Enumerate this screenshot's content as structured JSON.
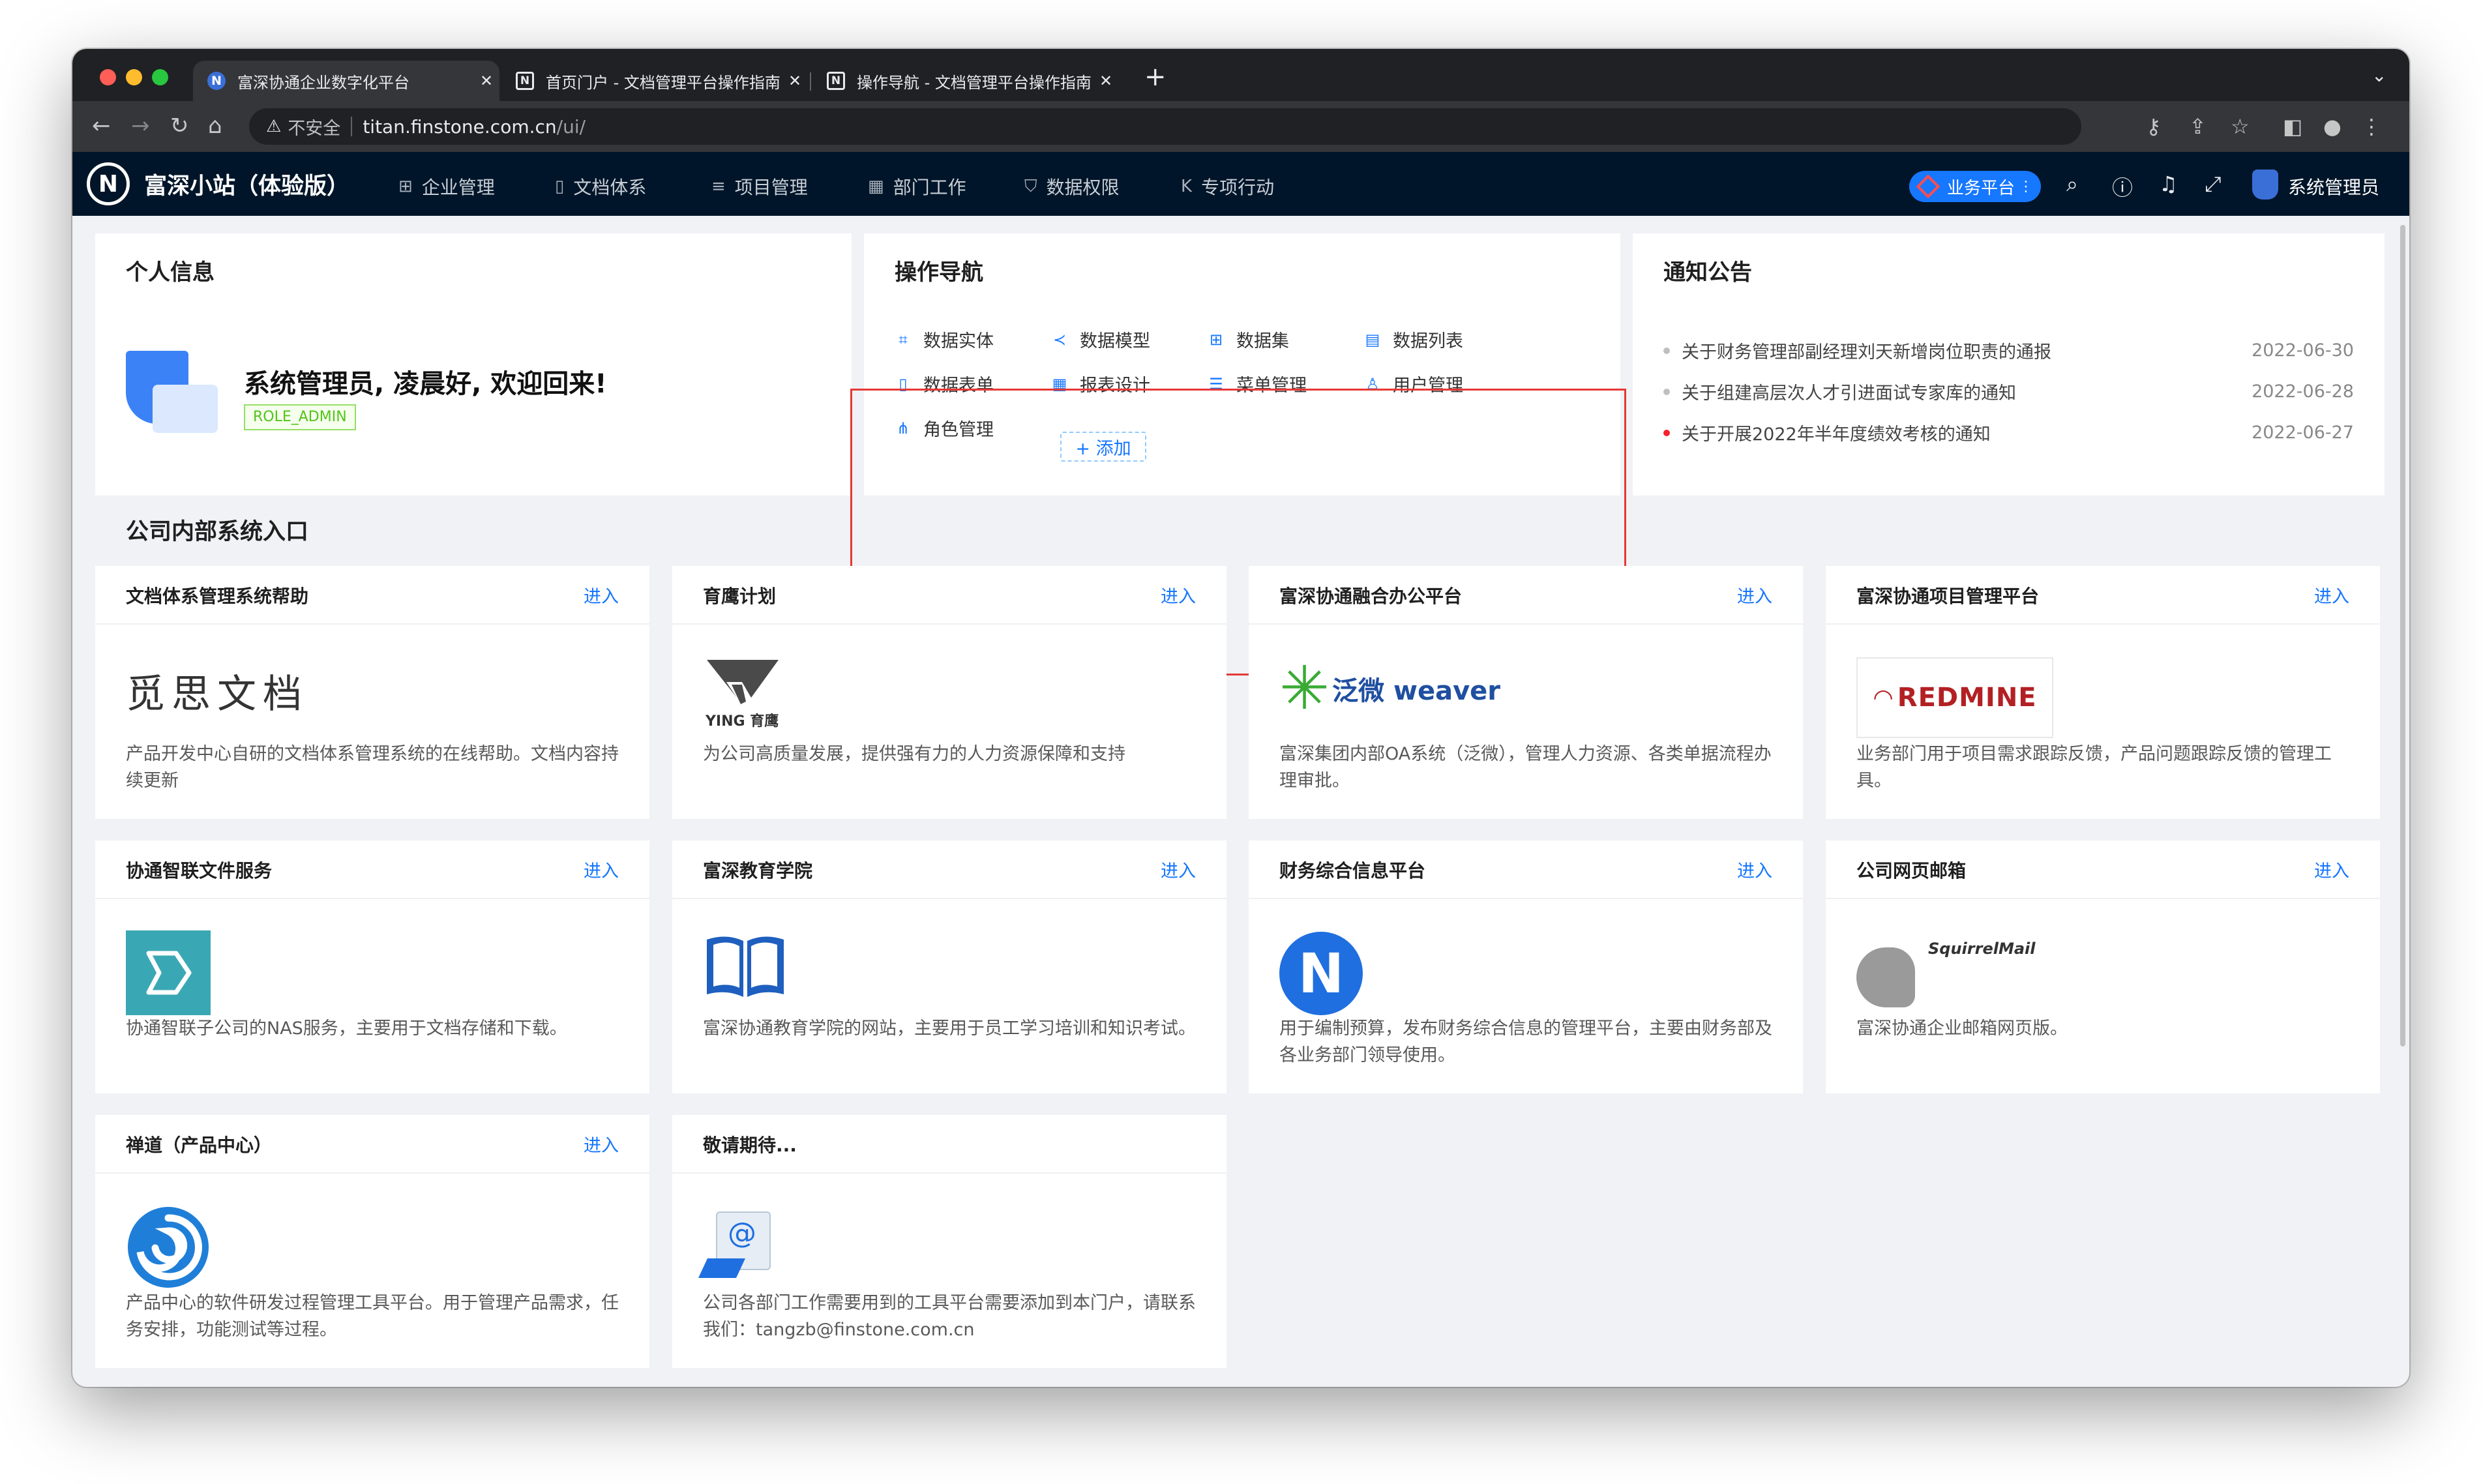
{
  "browser": {
    "tabs": [
      {
        "title": "富深协通企业数字化平台",
        "favicon": "n-logo-icon"
      },
      {
        "title": "首页门户 - 文档管理平台操作指南",
        "favicon": "doc-icon"
      },
      {
        "title": "操作导航 - 文档管理平台操作指南",
        "favicon": "doc-icon"
      }
    ],
    "security_label": "不安全",
    "url_host": "titan.finstone.com.cn",
    "url_path": "/ui/"
  },
  "appnav": {
    "logo": "N",
    "brand": "富深小站（体验版）",
    "menus": [
      {
        "label": "企业管理",
        "icon": "cluster-icon",
        "glyph": "⊞"
      },
      {
        "label": "文档体系",
        "icon": "file-icon",
        "glyph": "▯"
      },
      {
        "label": "项目管理",
        "icon": "list-icon",
        "glyph": "≡"
      },
      {
        "label": "部门工作",
        "icon": "table-icon",
        "glyph": "▦"
      },
      {
        "label": "数据权限",
        "icon": "shield-icon",
        "glyph": "⛉"
      },
      {
        "label": "专项行动",
        "icon": "k-icon",
        "glyph": "K"
      }
    ],
    "platform_button": "业务平台",
    "user": "系统管理员"
  },
  "profile": {
    "title": "个人信息",
    "greeting": "系统管理员, 凌晨好, 欢迎回来!",
    "role": "ROLE_ADMIN"
  },
  "operation_nav": {
    "title": "操作导航",
    "items": [
      {
        "label": "数据实体",
        "icon": "entity-icon",
        "glyph": "⌗"
      },
      {
        "label": "数据模型",
        "icon": "share-icon",
        "glyph": "≺"
      },
      {
        "label": "数据集",
        "icon": "appstore-icon",
        "glyph": "⊞"
      },
      {
        "label": "数据列表",
        "icon": "list-box-icon",
        "glyph": "▤"
      },
      {
        "label": "数据表单",
        "icon": "form-icon",
        "glyph": "▯"
      },
      {
        "label": "报表设计",
        "icon": "table-icon",
        "glyph": "▦"
      },
      {
        "label": "菜单管理",
        "icon": "menu-icon",
        "glyph": "☰"
      },
      {
        "label": "用户管理",
        "icon": "user-icon",
        "glyph": "♙"
      },
      {
        "label": "角色管理",
        "icon": "cluster-icon",
        "glyph": "⋔"
      }
    ],
    "add_label": "+ 添加"
  },
  "notices": {
    "title": "通知公告",
    "items": [
      {
        "text": "关于财务管理部副经理刘天新增岗位职责的通报",
        "date": "2022-06-30",
        "color": "#bfbfbf"
      },
      {
        "text": "关于组建高层次人才引进面试专家库的通知",
        "date": "2022-06-28",
        "color": "#bfbfbf"
      },
      {
        "text": "关于开展2022年半年度绩效考核的通知",
        "date": "2022-06-27",
        "color": "#f5222d"
      }
    ]
  },
  "systems": {
    "title": "公司内部系统入口",
    "enter_label": "进入",
    "items": [
      {
        "name": "文档体系管理系统帮助",
        "desc": "产品开发中心自研的文档体系管理系统的在线帮助。文档内容持续更新",
        "logo": "觅思文档",
        "enter": true
      },
      {
        "name": "育鹰计划",
        "desc": "为公司高质量发展，提供强有力的人力资源保障和支持",
        "logo": "YING 育鹰",
        "enter": true
      },
      {
        "name": "富深协通融合办公平台",
        "desc": "富深集团内部OA系统（泛微），管理人力资源、各类单据流程办理审批。",
        "logo": "泛微 weaver",
        "enter": true
      },
      {
        "name": "富深协通项目管理平台",
        "desc": "业务部门用于项目需求跟踪反馈，产品问题跟踪反馈的管理工具。",
        "logo": "REDMINE",
        "enter": true
      },
      {
        "name": "协通智联文件服务",
        "desc": "协通智联子公司的NAS服务，主要用于文档存储和下载。",
        "logo": "",
        "enter": true
      },
      {
        "name": "富深教育学院",
        "desc": "富深协通教育学院的网站，主要用于员工学习培训和知识考试。",
        "logo": "",
        "enter": true
      },
      {
        "name": "财务综合信息平台",
        "desc": "用于编制预算，发布财务综合信息的管理平台，主要由财务部及各业务部门领导使用。",
        "logo": "N",
        "enter": true
      },
      {
        "name": "公司网页邮箱",
        "desc": "富深协通企业邮箱网页版。",
        "logo": "SquirrelMail",
        "enter": true
      },
      {
        "name": "禅道（产品中心）",
        "desc": "产品中心的软件研发过程管理工具平台。用于管理产品需求，任务安排，功能测试等过程。",
        "logo": "",
        "enter": true
      },
      {
        "name": "敬请期待...",
        "desc": "公司各部门工作需要用到的工具平台需要添加到本门户，请联系我们：tangzb@finstone.com.cn",
        "logo": "@",
        "enter": false
      }
    ]
  }
}
